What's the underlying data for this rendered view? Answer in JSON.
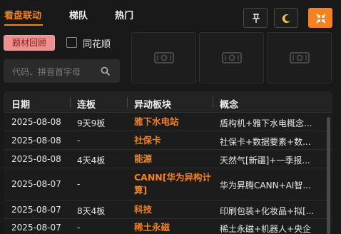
{
  "tabs": [
    {
      "label": "看盘联动",
      "active": true
    },
    {
      "label": "梯队",
      "active": false
    },
    {
      "label": "热门",
      "active": false
    }
  ],
  "toolbar": {
    "pin_icon": "pin-icon",
    "theme_icon": "moon-icon",
    "collapse_icon": "collapse-arrows-icon"
  },
  "filters": {
    "topic_review_label": "题材回顾",
    "tonghuashun_label": "同花顺",
    "tonghuashun_checked": false
  },
  "search": {
    "placeholder": "代码、拼音首字母"
  },
  "placeholder_cards": 3,
  "table": {
    "columns": [
      "日期",
      "连板",
      "异动板块",
      "概念"
    ],
    "rows": [
      {
        "date": "2025-08-08",
        "boards": "9天9板",
        "sector": "雅下水电站",
        "concept": "盾构机+雅下水电概念..."
      },
      {
        "date": "2025-08-08",
        "boards": "-",
        "sector": "社保卡",
        "concept": "社保卡+数据要素+数..."
      },
      {
        "date": "2025-08-08",
        "boards": "4天4板",
        "sector": "能源",
        "concept": "天然气[新疆]+一季报..."
      },
      {
        "date": "2025-08-07",
        "boards": "-",
        "sector": "CANN[华为异构计算]",
        "concept": "华为昇腾CANN+AI智..."
      },
      {
        "date": "2025-08-07",
        "boards": "8天4板",
        "sector": "科技",
        "concept": "印刷包装+化妆品+拟[..."
      },
      {
        "date": "2025-08-07",
        "boards": "-",
        "sector": "稀土永磁",
        "concept": "稀土永磁+机器人+央企"
      }
    ]
  },
  "colors": {
    "accent": "#f5821f",
    "background": "#191919",
    "pill": "#ef8f8f"
  }
}
